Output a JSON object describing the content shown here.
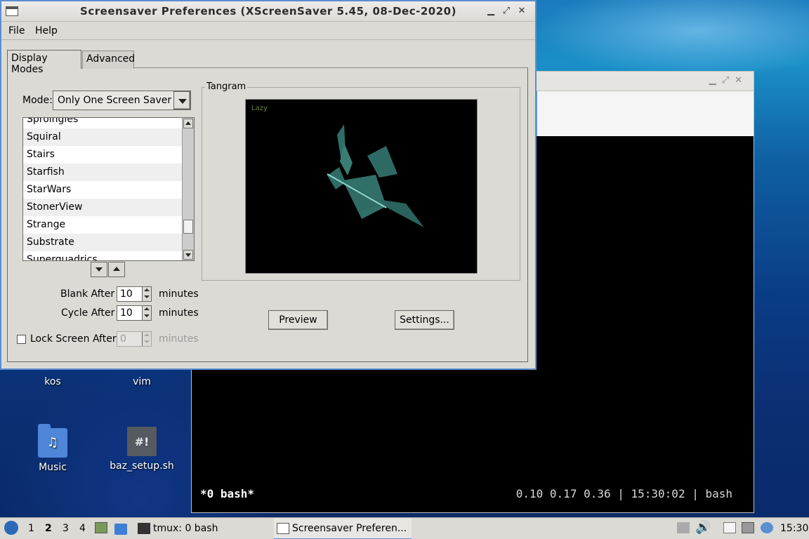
{
  "dialog": {
    "title": "Screensaver Preferences  (XScreenSaver 5.45, 08-Dec-2020)",
    "menu": [
      "File",
      "Help"
    ],
    "tabs": [
      "Display Modes",
      "Advanced"
    ],
    "mode_label": "Mode:",
    "mode_value": "Only One Screen Saver",
    "list_items": [
      "Sproingies",
      "Squiral",
      "Stairs",
      "Starfish",
      "StarWars",
      "StonerView",
      "Strange",
      "Substrate",
      "Superquadrics"
    ],
    "preview_group_label": "Tangram",
    "preview_tag": "Lazy",
    "blank_after_label": "Blank After",
    "blank_after_value": "10",
    "cycle_after_label": "Cycle After",
    "cycle_after_value": "10",
    "lock_label": "Lock Screen After",
    "lock_value": "0",
    "minutes_label": "minutes",
    "preview_button": "Preview",
    "settings_button": "Settings..."
  },
  "terminal": {
    "status_left": "*0 bash*",
    "status_right": "0.10 0.17 0.36 | 15:30:02 | bash"
  },
  "desktop_icons": [
    {
      "label": "kos",
      "icon": "folder-icon"
    },
    {
      "label": "vim",
      "icon": "folder-icon"
    },
    {
      "label": "Music",
      "icon": "music-folder-icon"
    },
    {
      "label": "baz_setup.sh",
      "icon": "script-file-icon"
    }
  ],
  "taskbar": {
    "workspaces": [
      "1",
      "2",
      "3",
      "4"
    ],
    "active_workspace": "2",
    "tasks": [
      "tmux: 0 bash",
      "Screensaver Preferen..."
    ],
    "clock": "15:30"
  }
}
